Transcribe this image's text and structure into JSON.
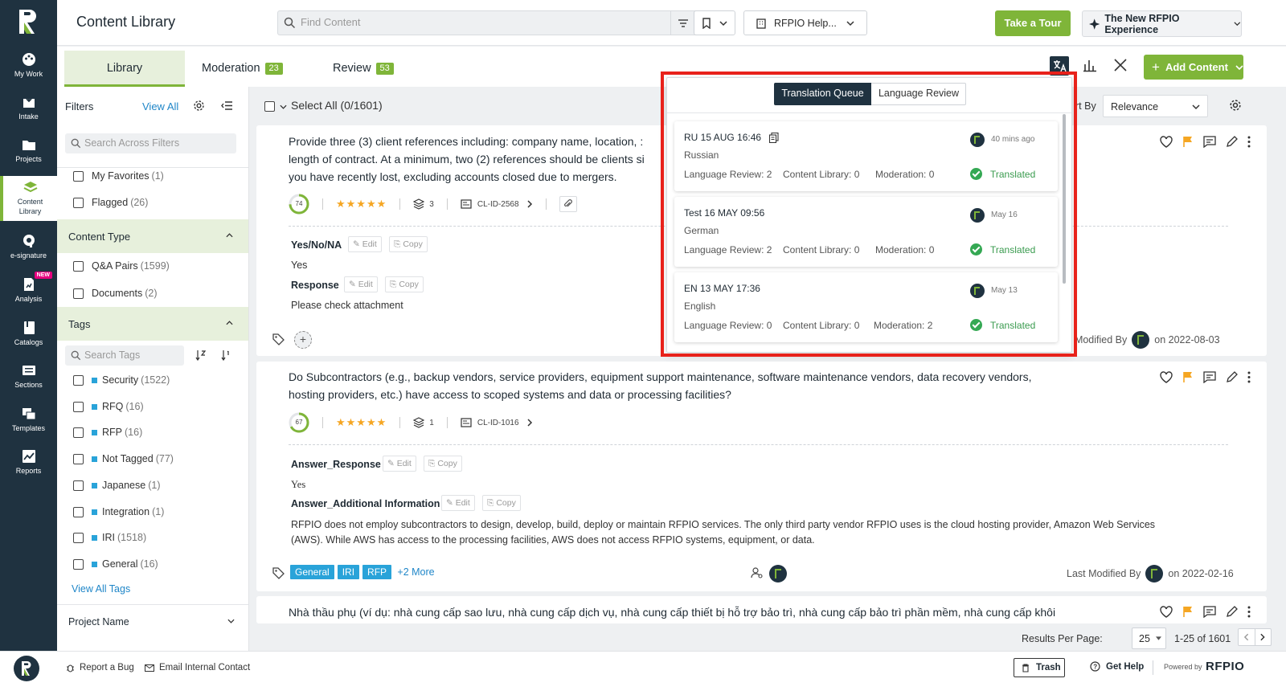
{
  "nav": {
    "items": [
      {
        "label": "My Work"
      },
      {
        "label": "Intake"
      },
      {
        "label": "Projects"
      },
      {
        "label": "Content Library"
      },
      {
        "label": "e-signature"
      },
      {
        "label": "Analysis",
        "badge": "NEW"
      },
      {
        "label": "Catalogs"
      },
      {
        "label": "Sections"
      },
      {
        "label": "Templates"
      },
      {
        "label": "Reports"
      }
    ]
  },
  "header": {
    "title": "Content Library",
    "search_placeholder": "Find Content",
    "help_select": "RFPIO Help...",
    "tour_label": "Take a Tour",
    "new_experience": "The New RFPIO Experience"
  },
  "tabs": [
    {
      "label": "Library"
    },
    {
      "label": "Moderation",
      "count": "23"
    },
    {
      "label": "Review",
      "count": "53"
    }
  ],
  "add_content_label": "Add Content",
  "filters": {
    "title": "Filters",
    "view_all": "View All",
    "search_placeholder": "Search Across Filters",
    "quick": [
      {
        "label": "My Favorites",
        "count": "(1)"
      },
      {
        "label": "Flagged",
        "count": "(26)"
      }
    ],
    "content_type_title": "Content Type",
    "content_types": [
      {
        "label": "Q&A Pairs",
        "count": "(1599)"
      },
      {
        "label": "Documents",
        "count": "(2)"
      }
    ],
    "tags_title": "Tags",
    "tags_search_placeholder": "Search Tags",
    "tags": [
      {
        "label": "Security",
        "count": "(1522)"
      },
      {
        "label": "RFQ",
        "count": "(16)"
      },
      {
        "label": "RFP",
        "count": "(16)"
      },
      {
        "label": "Not Tagged",
        "count": "(77)"
      },
      {
        "label": "Japanese",
        "count": "(1)"
      },
      {
        "label": "Integration",
        "count": "(1)"
      },
      {
        "label": "IRI",
        "count": "(1518)"
      },
      {
        "label": "General",
        "count": "(16)"
      }
    ],
    "view_all_tags": "View All Tags",
    "project_name_title": "Project Name"
  },
  "toolbar": {
    "select_all": "Select All (0/1601)",
    "sort_by_fragment": "rt By",
    "sort_value": "Relevance"
  },
  "cards": [
    {
      "question_lines": [
        "Provide three (3) client references including: company name, location, :",
        "length of contract. At a minimum, two (2) references should be clients si",
        "you have recently lost, excluding accounts closed due to mergers."
      ],
      "score": "74",
      "score_pct": 0.74,
      "stars": "★★★★★",
      "versions": "3",
      "id": "CL-ID-2568",
      "fields": [
        {
          "label": "Yes/No/NA",
          "value": "Yes"
        },
        {
          "label": "Response",
          "value": "Please check attachment"
        }
      ],
      "last_modified_fragment": ": Modified By",
      "date": "on  2022-08-03"
    },
    {
      "question_lines": [
        "Do Subcontractors (e.g., backup vendors, service providers, equipment support maintenance, software maintenance vendors, data recovery vendors,",
        "hosting providers, etc.) have access to scoped systems and data or processing facilities?"
      ],
      "score": "67",
      "score_pct": 0.67,
      "stars": "★★★★★",
      "versions": "1",
      "id": "CL-ID-1016",
      "fields": [
        {
          "label": "Answer_Response",
          "value": "Yes"
        },
        {
          "label": "Answer_Additional Information",
          "value_lines": [
            "RFPIO does not employ subcontractors to design, develop, build, deploy or maintain RFPIO services. The only third party vendor RFPIO uses is the cloud hosting provider, Amazon Web Services",
            "(AWS). While AWS has access to the processing facilities, AWS does not access RFPIO systems, equipment, or data."
          ]
        }
      ],
      "tags": [
        "General",
        "IRI",
        "RFP"
      ],
      "more_tags": "+2 More",
      "last_modified": "Last Modified By",
      "date": "on  2022-02-16"
    },
    {
      "question_line": "Nhà thầu phụ (ví dụ: nhà cung cấp sao lưu, nhà cung cấp dịch vụ, nhà cung cấp thiết bị hỗ trợ bảo trì, nhà cung cấp bảo trì phần mềm, nhà cung cấp khôi"
    }
  ],
  "common": {
    "edit": "Edit",
    "copy": "Copy"
  },
  "pagination": {
    "label": "Results Per Page:",
    "per_page": "25",
    "range": "1-25 of 1601"
  },
  "footer": {
    "report_bug": "Report a Bug",
    "email_contact": "Email Internal Contact",
    "trash": "Trash",
    "get_help": "Get Help",
    "powered_by": "Powered by",
    "brand": "RFPIO"
  },
  "popover": {
    "tabs": [
      "Translation Queue",
      "Language Review"
    ],
    "items": [
      {
        "title": "RU 15 AUG 16:46",
        "language": "Russian",
        "time": "40 mins ago",
        "lang_review": "Language Review: 2",
        "content_library": "Content Library: 0",
        "moderation": "Moderation: 0",
        "status": "Translated",
        "lang_review_link": true,
        "moderation_link": false
      },
      {
        "title": "Test 16 MAY 09:56",
        "language": "German",
        "time": "May 16",
        "lang_review": "Language Review: 2",
        "content_library": "Content Library: 0",
        "moderation": "Moderation: 0",
        "status": "Translated",
        "lang_review_link": true,
        "moderation_link": false
      },
      {
        "title": "EN 13 MAY 17:36",
        "language": "English",
        "time": "May 13",
        "lang_review": "Language Review: 0",
        "content_library": "Content Library: 0",
        "moderation": "Moderation: 2",
        "status": "Translated",
        "lang_review_link": false,
        "moderation_link": true
      }
    ]
  },
  "colors": {
    "accent": "#7fb539",
    "nav": "#1f3240",
    "link": "#1f86c8",
    "tag": "#29a3d9",
    "highlight": "#e8221b"
  }
}
